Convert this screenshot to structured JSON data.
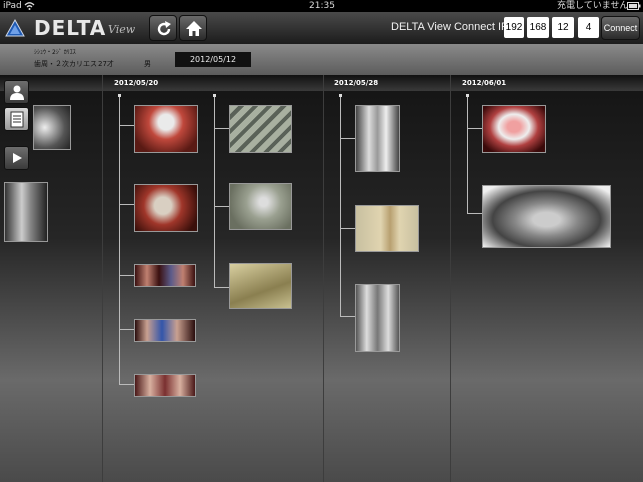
{
  "status_bar": {
    "device": "iPad",
    "time": "21:35",
    "battery": "充電していません"
  },
  "header": {
    "logo_text": "DELTA",
    "logo_sub": "View",
    "connect_label": "DELTA View Connect IP",
    "ip": [
      "192",
      "168",
      "12",
      "4"
    ],
    "connect_button": "Connect"
  },
  "patient": {
    "kana": "ｼｼｭｳ・2ｼﾞ ｶﾘｴｽ",
    "name": "歯周・２次カリエス",
    "age": "27才",
    "sex": "男",
    "date": "2012/05/12"
  },
  "timeline": {
    "dates": [
      "2012/05/20",
      "2012/05/28",
      "2012/06/01"
    ]
  }
}
